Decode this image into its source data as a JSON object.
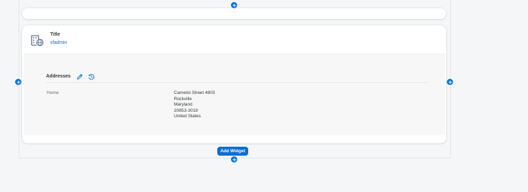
{
  "header_card": {
    "title": "Title",
    "subtitle": "sfadmin",
    "icon": "globe-building-icon"
  },
  "addresses": {
    "section_title": "Addresses",
    "edit_icon": "edit-icon",
    "history_icon": "history-icon",
    "rows": [
      {
        "label": "Home",
        "lines": [
          "Camelot Street 4803",
          "Rockville",
          "Maryland",
          "20853-3019",
          "United States"
        ]
      }
    ]
  },
  "controls": {
    "add_widget_label": "Add Widget",
    "plus_icon": "plus-icon"
  },
  "colors": {
    "accent": "#0a6ed1",
    "text": "#32363a",
    "muted": "#6a6d70",
    "background": "#f4f6f8",
    "card": "#ffffff",
    "card_body": "#f7f7f7"
  }
}
